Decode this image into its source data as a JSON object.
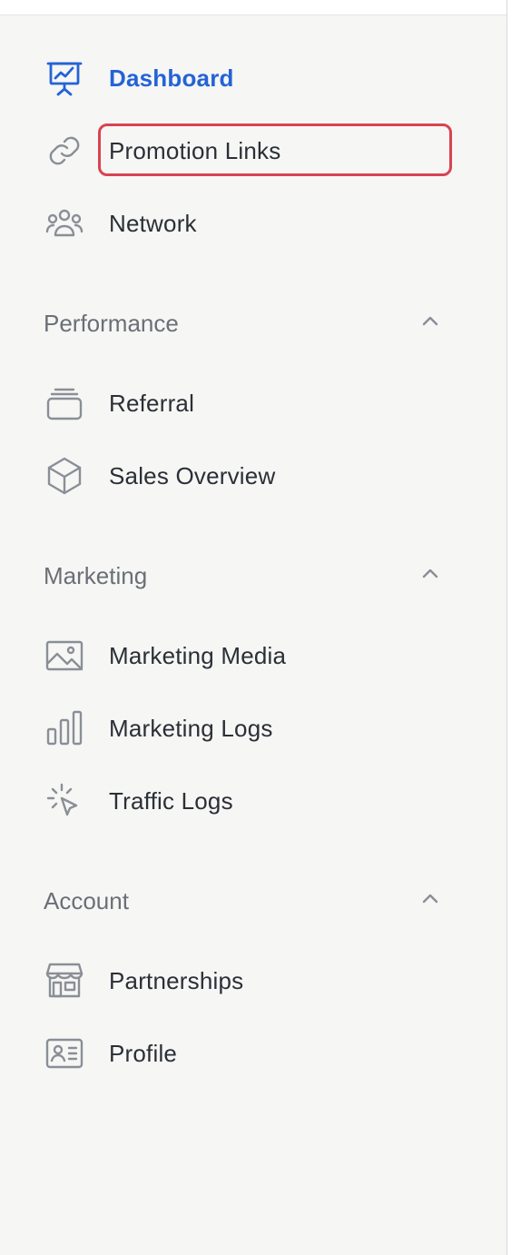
{
  "nav": {
    "top_items": [
      {
        "label": "Dashboard",
        "icon": "presentation-chart-icon",
        "active": true
      },
      {
        "label": "Promotion Links",
        "icon": "link-icon",
        "active": false
      },
      {
        "label": "Network",
        "icon": "users-group-icon",
        "active": false
      }
    ],
    "sections": [
      {
        "title": "Performance",
        "expanded": true,
        "items": [
          {
            "label": "Referral",
            "icon": "stack-icon"
          },
          {
            "label": "Sales Overview",
            "icon": "cube-icon"
          }
        ]
      },
      {
        "title": "Marketing",
        "expanded": true,
        "items": [
          {
            "label": "Marketing Media",
            "icon": "image-icon"
          },
          {
            "label": "Marketing Logs",
            "icon": "bar-chart-icon"
          },
          {
            "label": "Traffic Logs",
            "icon": "cursor-click-icon"
          }
        ]
      },
      {
        "title": "Account",
        "expanded": true,
        "items": [
          {
            "label": "Partnerships",
            "icon": "storefront-icon"
          },
          {
            "label": "Profile",
            "icon": "id-card-icon"
          }
        ]
      }
    ]
  },
  "colors": {
    "active": "#2463d6",
    "text": "#2b2f36",
    "section_title": "#6b6f76",
    "icon": "#8a8f96",
    "highlight": "#d9434f",
    "background": "#f6f6f5"
  }
}
